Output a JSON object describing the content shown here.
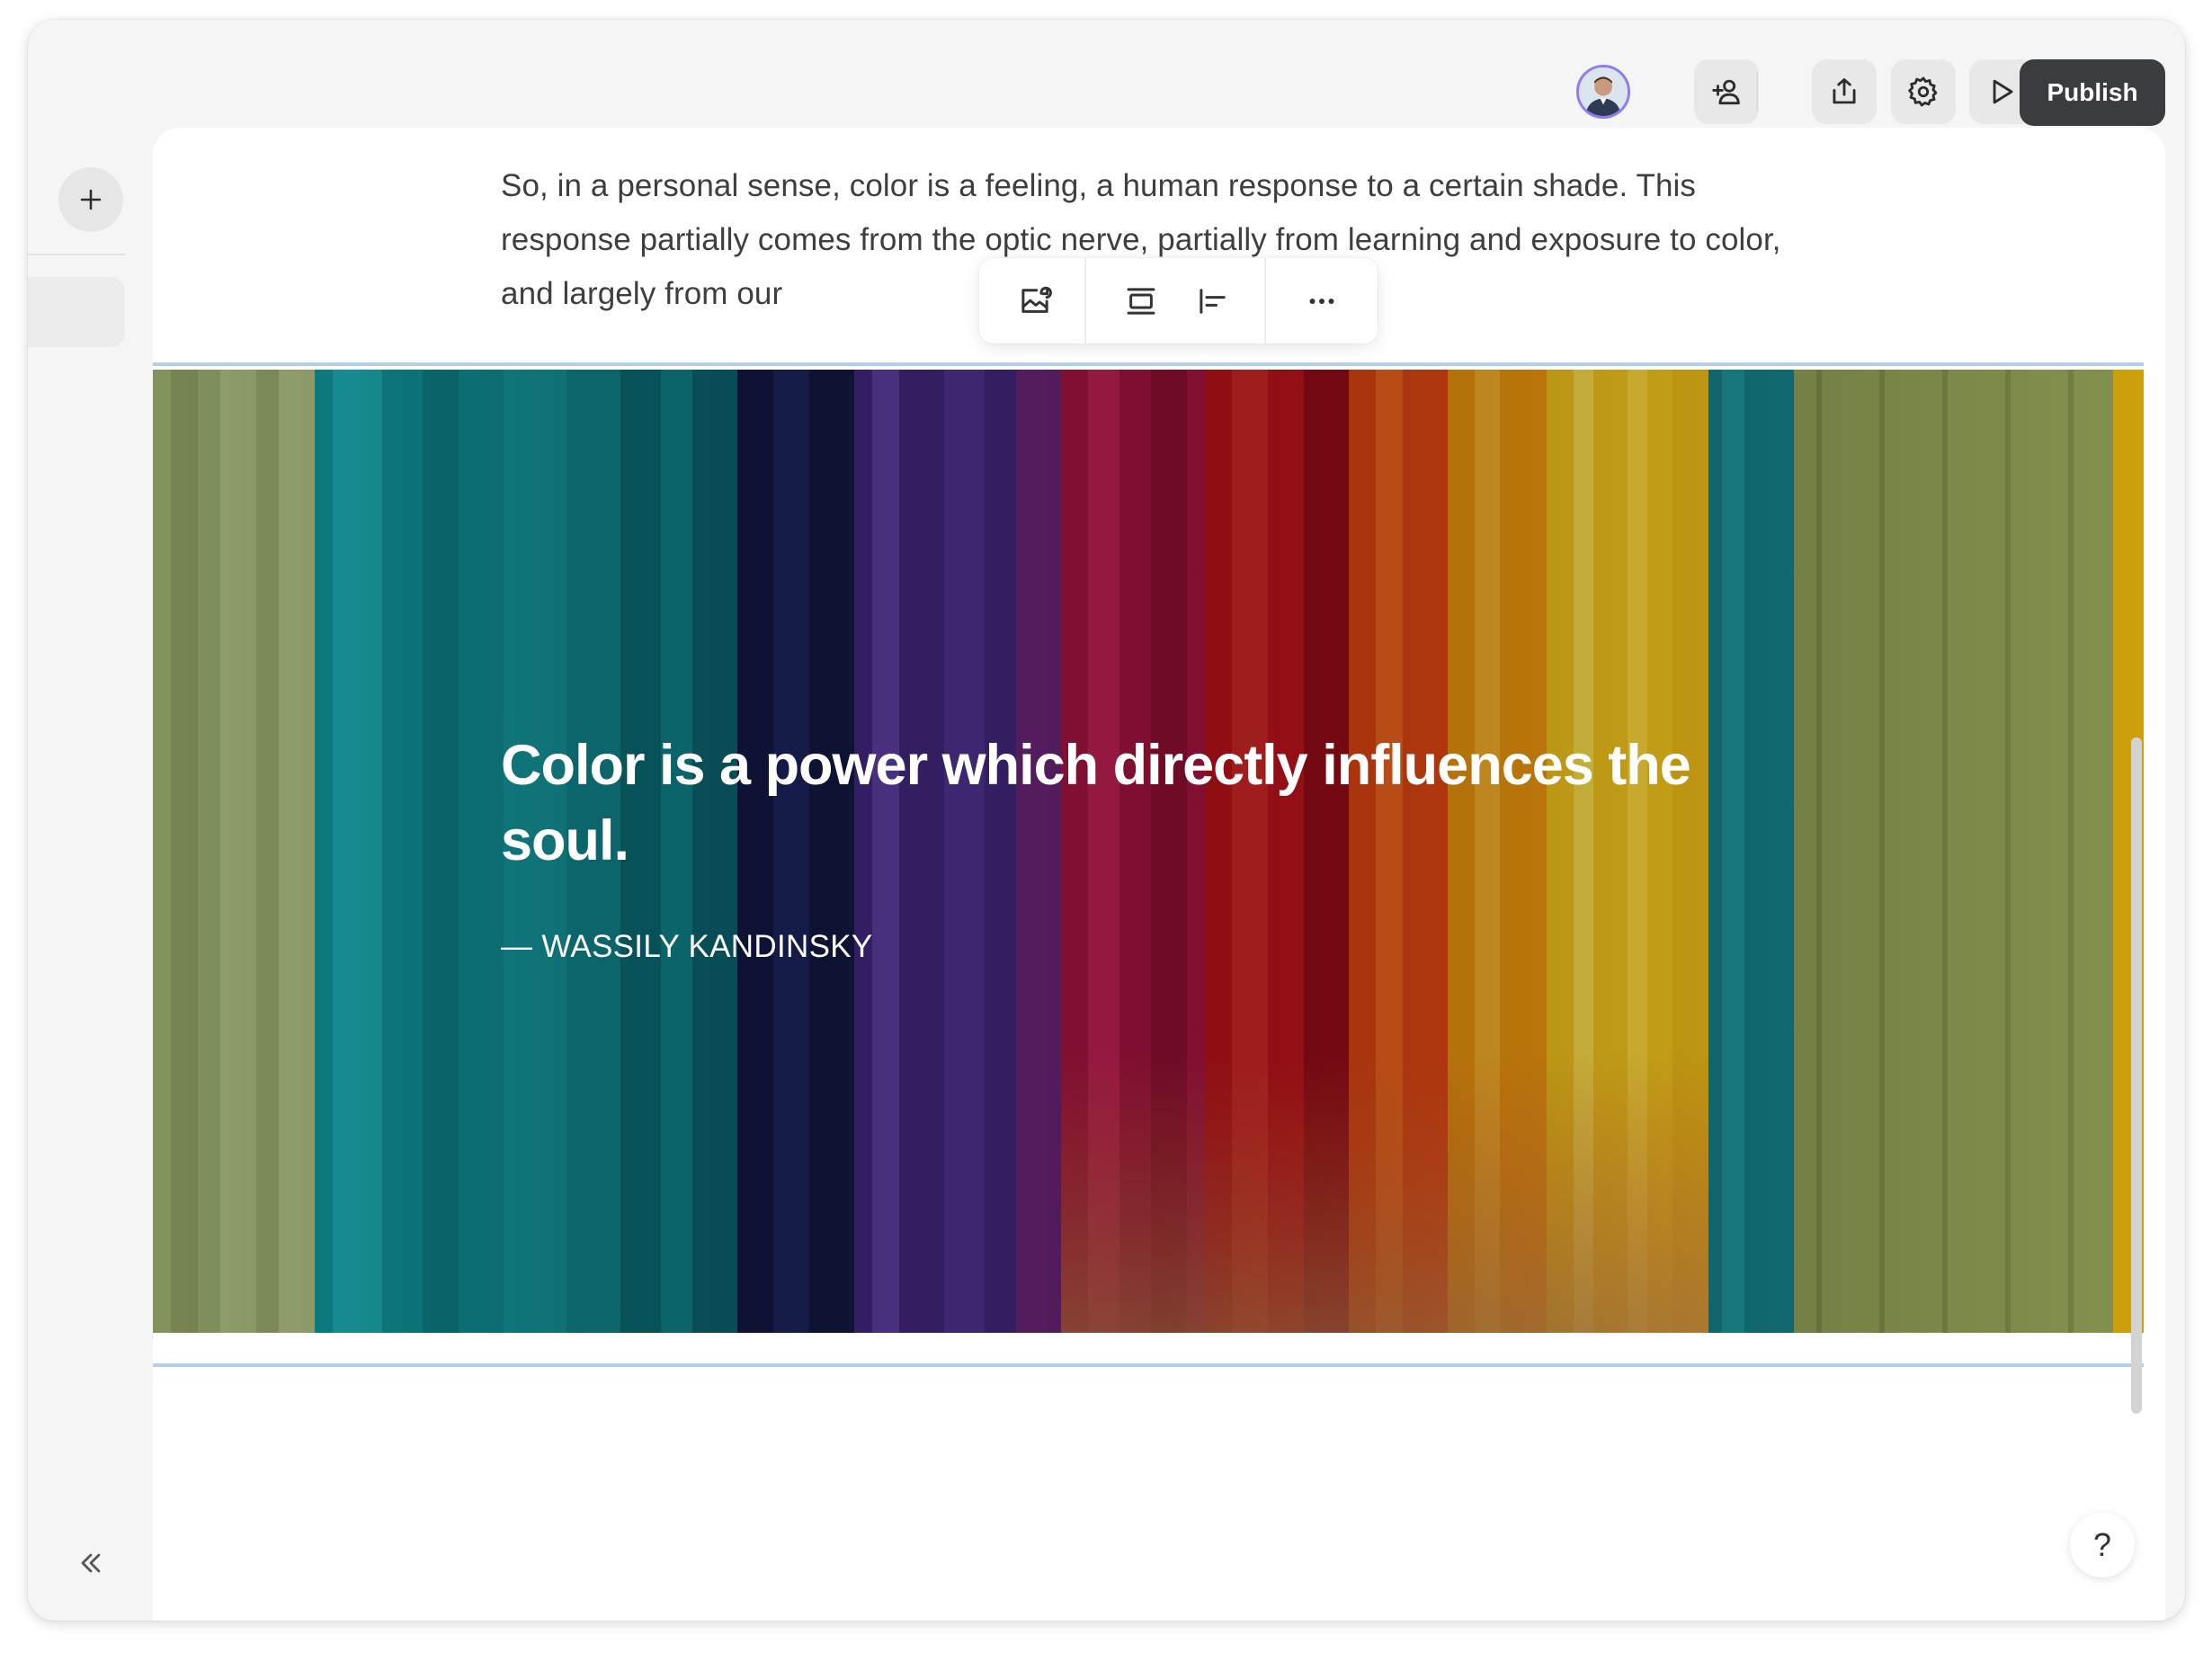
{
  "topbar": {
    "avatar_icon": "user-avatar",
    "invite_icon": "add-user-icon",
    "share_icon": "share-upload-icon",
    "settings_icon": "gear-icon",
    "preview_icon": "play-icon",
    "publish_label": "Publish",
    "publish_color": "#3a3c40"
  },
  "sidebar": {
    "add_icon": "plus-icon",
    "collapse_icon": "double-chevron-left-icon"
  },
  "document": {
    "paragraph": "So, in a personal sense, color is a feeling, a human response to a certain shade. This response partially comes from the optic nerve, partially from learning and exposure to color, and largely from our"
  },
  "block_toolbar": {
    "items": [
      "replace-image-icon",
      "full-width-layout-icon",
      "align-left-layout-icon",
      "more-options-icon"
    ]
  },
  "quote_block": {
    "quote": "Color is a power which directly influences the soul.",
    "author": "— WASSILY KANDINSKY",
    "selection_color": "#b4cfee"
  },
  "help": {
    "label": "?"
  }
}
